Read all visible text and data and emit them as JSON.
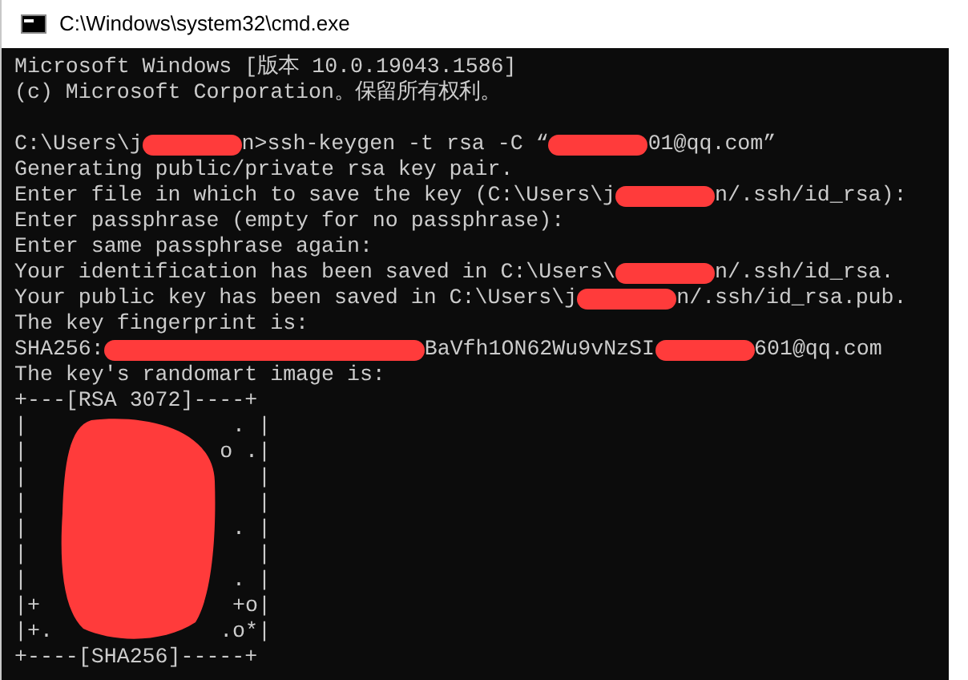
{
  "window": {
    "title": "C:\\Windows\\system32\\cmd.exe"
  },
  "console_lines": [
    {
      "kind": "text",
      "segments": [
        {
          "kind": "text",
          "text": "Microsoft Windows [版本 10.0.19043.1586]"
        }
      ]
    },
    {
      "kind": "text",
      "segments": [
        {
          "kind": "text",
          "text": "(c) Microsoft Corporation。保留所有权利。"
        }
      ]
    },
    {
      "kind": "blank"
    },
    {
      "kind": "text",
      "segments": [
        {
          "kind": "text",
          "text": "C:\\Users\\j"
        },
        {
          "kind": "redaction"
        },
        {
          "kind": "text",
          "text": "n>ssh-keygen -t rsa -C “"
        },
        {
          "kind": "redaction"
        },
        {
          "kind": "text",
          "text": "01@qq.com”"
        }
      ]
    },
    {
      "kind": "text",
      "segments": [
        {
          "kind": "text",
          "text": "Generating public/private rsa key pair."
        }
      ]
    },
    {
      "kind": "text",
      "segments": [
        {
          "kind": "text",
          "text": "Enter file in which to save the key (C:\\Users\\j"
        },
        {
          "kind": "redaction"
        },
        {
          "kind": "text",
          "text": "n/.ssh/id_rsa):"
        }
      ]
    },
    {
      "kind": "text",
      "segments": [
        {
          "kind": "text",
          "text": "Enter passphrase (empty for no passphrase):"
        }
      ]
    },
    {
      "kind": "text",
      "segments": [
        {
          "kind": "text",
          "text": "Enter same passphrase again:"
        }
      ]
    },
    {
      "kind": "text",
      "segments": [
        {
          "kind": "text",
          "text": "Your identification has been saved in C:\\Users\\"
        },
        {
          "kind": "redaction"
        },
        {
          "kind": "text",
          "text": "n/.ssh/id_rsa."
        }
      ]
    },
    {
      "kind": "text",
      "segments": [
        {
          "kind": "text",
          "text": "Your public key has been saved in C:\\Users\\j"
        },
        {
          "kind": "redaction"
        },
        {
          "kind": "text",
          "text": "n/.ssh/id_rsa.pub."
        }
      ]
    },
    {
      "kind": "text",
      "segments": [
        {
          "kind": "text",
          "text": "The key fingerprint is:"
        }
      ]
    },
    {
      "kind": "text",
      "segments": [
        {
          "kind": "text",
          "text": "SHA256:"
        },
        {
          "kind": "redaction-long"
        },
        {
          "kind": "text",
          "text": "BaVfh1ON62Wu9vNzSI"
        },
        {
          "kind": "redaction"
        },
        {
          "kind": "text",
          "text": "601@qq.com"
        }
      ]
    },
    {
      "kind": "text",
      "segments": [
        {
          "kind": "text",
          "text": "The key's randomart image is:"
        }
      ]
    }
  ],
  "randomart": {
    "top": "+---[RSA 3072]----+",
    "rows": [
      {
        "left": "|",
        "right": ". |"
      },
      {
        "left": "|",
        "right": "o .|"
      },
      {
        "left": "|",
        "right": "|"
      },
      {
        "left": "|",
        "right": "|"
      },
      {
        "left": "|",
        "right": ". |"
      },
      {
        "left": "|",
        "right": "|"
      },
      {
        "left": "|",
        "right": ". |"
      },
      {
        "left": "|+",
        "right": "+o|"
      },
      {
        "left": "|+.",
        "right": ".o*|"
      }
    ],
    "bottom": "+----[SHA256]-----+"
  }
}
